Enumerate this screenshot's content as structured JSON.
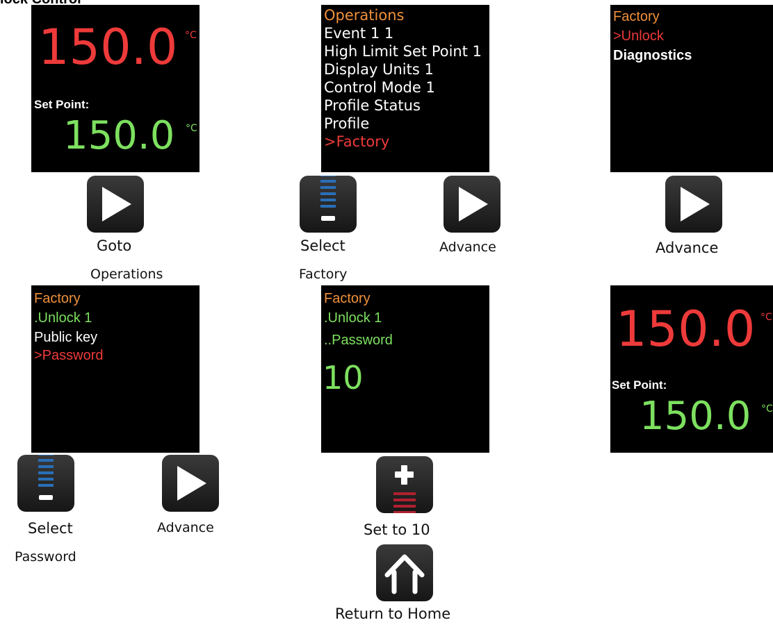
{
  "heading": "lock Control",
  "screens": {
    "home1": {
      "pv": "150.0",
      "pv_unit": "°C",
      "sp_label": "Set Point:",
      "sp": "150.0",
      "sp_unit": "°C"
    },
    "operations": {
      "title": "Operations",
      "items": [
        "Event 1 1",
        "High Limit Set Point 1",
        "Display Units 1",
        "Control Mode 1",
        "Profile Status",
        "Profile"
      ],
      "selected": ">Factory"
    },
    "factory": {
      "title": "Factory",
      "selected": ">Unlock",
      "other": "Diagnostics"
    },
    "unlock": {
      "title": "Factory",
      "sub": ".Unlock 1",
      "item": "Public key",
      "selected": ">Password"
    },
    "password": {
      "title": "Factory",
      "sub": ".Unlock 1",
      "sub2": "..Password",
      "value": "10"
    },
    "home2": {
      "pv": "150.0",
      "pv_unit": "°C",
      "sp_label": "Set Point:",
      "sp": "150.0",
      "sp_unit": "°C"
    }
  },
  "buttons": {
    "goto_operations": {
      "icon": "advance-icon",
      "caption1": "Goto",
      "caption2": "Operations"
    },
    "select_factory": {
      "icon": "down-icon",
      "caption1": "Select",
      "caption2": "Factory"
    },
    "advance_2": {
      "icon": "advance-icon",
      "caption": "Advance"
    },
    "advance_3": {
      "icon": "advance-icon",
      "caption": "Advance"
    },
    "select_password": {
      "icon": "down-icon",
      "caption1": "Select",
      "caption2": "Password"
    },
    "advance_4": {
      "icon": "advance-icon",
      "caption": "Advance"
    },
    "set_10": {
      "icon": "up-icon",
      "caption": "Set to 10"
    },
    "home": {
      "icon": "home-icon",
      "caption": "Return to Home"
    }
  },
  "colors": {
    "orange": "#f0913c",
    "red": "#ee3a3a",
    "green": "#7de05f",
    "blue": "#2a6fb8"
  }
}
